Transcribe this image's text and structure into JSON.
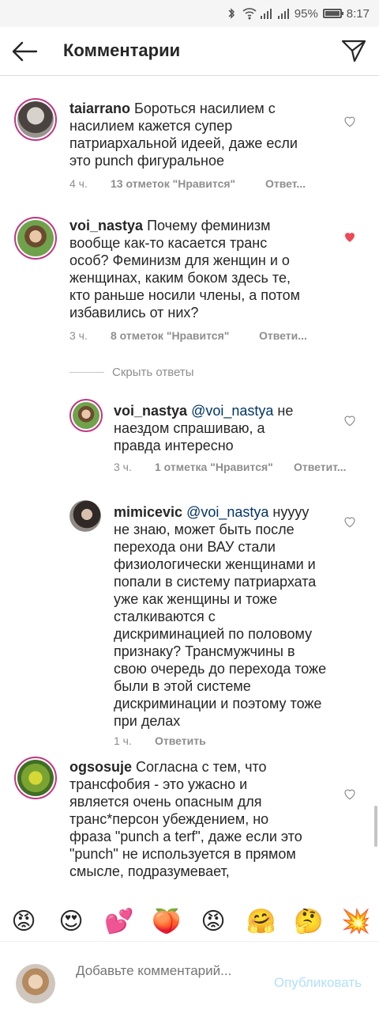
{
  "status_bar": {
    "battery": "95%",
    "time": "8:17"
  },
  "header": {
    "title": "Комментарии"
  },
  "comments": [
    {
      "user": "taiarrano",
      "text": " Бороться насилием с насилием кажется супер патриархальной идеей, даже если это punch фигуральное",
      "time": "4 ч.",
      "likes": "13 отметок \"Нравится\"",
      "reply": "Ответ...",
      "liked": false
    },
    {
      "user": "voi_nastya",
      "text": " Почему феминизм вообще как-то касается транс особ? Феминизм для женщин и о женщинах, каким боком здесь те, кто раньше носили члены, а потом избавились от них?",
      "time": "3 ч.",
      "likes": "8 отметок \"Нравится\"",
      "reply": "Ответи...",
      "liked": true
    }
  ],
  "hide_replies": "Скрыть ответы",
  "replies": [
    {
      "user": "voi_nastya",
      "mention": "@voi_nastya",
      "text": " не наездом спрашиваю, а правда интересно",
      "time": "3 ч.",
      "likes": "1 отметка \"Нравится\"",
      "reply": "Ответит..."
    },
    {
      "user": "mimicevic",
      "mention": "@voi_nastya",
      "text": " нуууу не знаю, может быть после перехода они ВАУ стали физиологически женщинами и попали в систему патриархата уже как женщины и тоже сталкиваются с дискриминацией по половому признаку? Трансмужчины в свою очередь до перехода тоже были в этой системе дискриминации и поэтому тоже при делах",
      "time": "1 ч.",
      "reply": "Ответить"
    }
  ],
  "last_comment": {
    "user": "ogsosuje",
    "text": " Согласна с тем, что трансфобия - это ужасно и является очень опасным для транс*персон убеждением, но фраза \"punch a terf\", даже если это \"punch\" не используется в прямом смысле, подразумевает,"
  },
  "reactions": [
    "😡",
    "😍",
    "💕",
    "🍑",
    "😡",
    "🤗",
    "🤔",
    "💥"
  ],
  "composer": {
    "placeholder": "Добавьте комментарий...",
    "publish": "Опубликовать"
  },
  "colors": {
    "heart_liked": "#ed4956",
    "story_ring": "#c13584",
    "publish": "#b2dffc"
  }
}
